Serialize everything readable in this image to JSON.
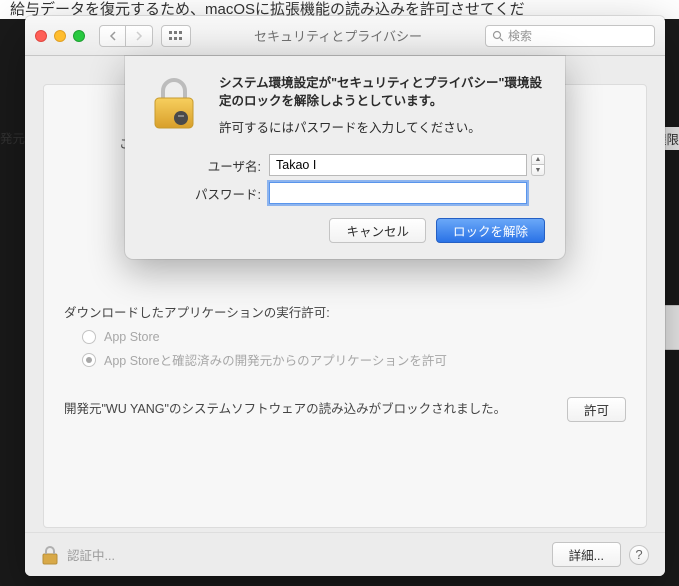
{
  "backdrop": {
    "top_line": "給与データを復元するため、macOSに拡張機能の読み込みを許可させてくだ",
    "left_text": "発元",
    "right_text": "権限"
  },
  "toolbar": {
    "title": "セキュリティとプライバシー",
    "search_placeholder": "検索"
  },
  "pane": {
    "peek_text": "このコ",
    "download_label": "ダウンロードしたアプリケーションの実行許可:",
    "radio_appstore": "App Store",
    "radio_identified": "App Storeと確認済みの開発元からのアプリケーションを許可",
    "blocked_msg": "開発元\"WU YANG\"のシステムソフトウェアの読み込みがブロックされました。",
    "allow_btn": "許可"
  },
  "footer": {
    "status": "認証中...",
    "details": "詳細..."
  },
  "dialog": {
    "bold_line": "システム環境設定が\"セキュリティとプライバシー\"環境設定のロックを解除しようとしています。",
    "sub_line": "許可するにはパスワードを入力してください。",
    "user_label": "ユーザ名:",
    "user_value": "Takao I",
    "pass_label": "パスワード:",
    "pass_value": "",
    "cancel": "キャンセル",
    "unlock": "ロックを解除"
  }
}
